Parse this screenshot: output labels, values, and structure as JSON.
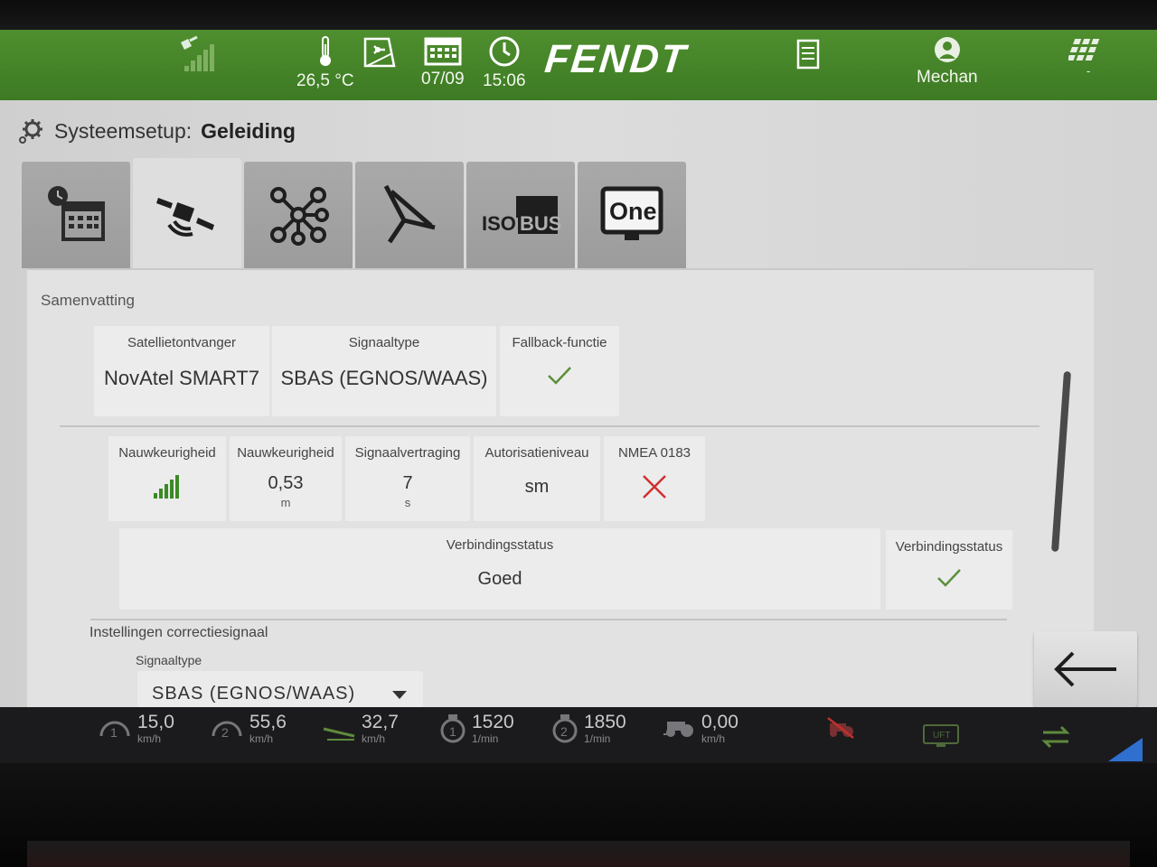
{
  "status_bar": {
    "temperature": "26,5 °C",
    "date": "07/09",
    "time": "15:06",
    "brand": "FENDT",
    "user": "Mechan",
    "user_sub": "-",
    "icons": [
      "signal-strength-icon",
      "thermometer-icon",
      "fan-window-icon",
      "calendar-icon",
      "clock-icon",
      "checklist-icon",
      "user-icon",
      "keypad-icon"
    ]
  },
  "header": {
    "title_prefix": "Systeemsetup:",
    "title_page": "Geleiding"
  },
  "tabs": [
    {
      "name": "time-date",
      "icon": "clock-calendar-icon",
      "active": false
    },
    {
      "name": "guidance",
      "icon": "satellite-icon",
      "active": true
    },
    {
      "name": "network",
      "icon": "network-nodes-icon",
      "active": false
    },
    {
      "name": "implement",
      "icon": "implement-icon",
      "active": false
    },
    {
      "name": "isobus",
      "icon": "isobus-icon",
      "label": "ISOBUS",
      "active": false
    },
    {
      "name": "one",
      "icon": "one-display-icon",
      "label": "One",
      "active": false
    }
  ],
  "summary": {
    "section_label": "Samenvatting",
    "receiver_header": "Satellietontvanger",
    "receiver_value": "NovAtel SMART7",
    "signal_type_header": "Signaaltype",
    "signal_type_value": "SBAS (EGNOS/WAAS)",
    "fallback_header": "Fallback-functie",
    "fallback_value": "check",
    "accuracy_header": "Nauwkeurigheid",
    "accuracy_bars_header": "Nauwkeurigheid",
    "accuracy_bars_level": 1.0,
    "accuracy_value": "0,53",
    "accuracy_unit": "m",
    "delay_header": "Signaalvertraging",
    "delay_value": "7",
    "delay_unit": "s",
    "auth_header": "Autorisatieniveau",
    "auth_value": "sm",
    "nmea_header": "NMEA 0183",
    "nmea_value": "cross",
    "connection_header": "Verbindingsstatus",
    "connection_value": "Goed",
    "connection_status_header": "Verbindingsstatus",
    "connection_status_value": "check"
  },
  "correction": {
    "section_label": "Instellingen correctiesignaal",
    "signal_type_label": "Signaaltype",
    "signal_type_value": "SBAS (EGNOS/WAAS)"
  },
  "bottom_bar": {
    "speed1_value": "15,0",
    "speed1_unit": "km/h",
    "speed2_value": "55,6",
    "speed2_unit": "km/h",
    "speed3_value": "32,7",
    "speed3_unit": "km/h",
    "rpm1_value": "1520",
    "rpm1_unit": "1/min",
    "rpm2_value": "1850",
    "rpm2_unit": "1/min",
    "ground_speed_value": "0,00",
    "ground_speed_unit": "km/h"
  },
  "colors": {
    "topbar_green": "#4a8a2b",
    "check_green": "#5a8f3a",
    "cross_red": "#d03030",
    "signal_green": "#3b8a26"
  }
}
